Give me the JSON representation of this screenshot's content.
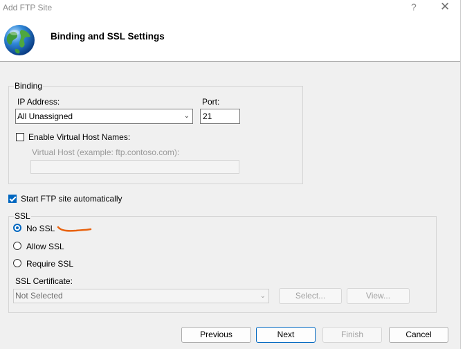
{
  "window": {
    "title": "Add FTP Site",
    "help_glyph": "?",
    "close_glyph": "✕"
  },
  "header": {
    "title": "Binding and SSL Settings",
    "icon": "globe-icon"
  },
  "binding": {
    "group_label": "Binding",
    "ip_label": "IP Address:",
    "ip_value": "All Unassigned",
    "port_label": "Port:",
    "port_value": "21",
    "virtual_hosts_label": "Enable Virtual Host Names:",
    "virtual_hosts_checked": false,
    "virtual_host_label": "Virtual Host (example: ftp.contoso.com):",
    "virtual_host_value": ""
  },
  "start_auto": {
    "label": "Start FTP site automatically",
    "checked": true
  },
  "ssl": {
    "group_label": "SSL",
    "options": [
      {
        "label": "No SSL",
        "checked": true
      },
      {
        "label": "Allow SSL",
        "checked": false
      },
      {
        "label": "Require SSL",
        "checked": false
      }
    ],
    "cert_label": "SSL Certificate:",
    "cert_value": "Not Selected",
    "select_button": "Select...",
    "view_button": "View..."
  },
  "footer": {
    "previous": "Previous",
    "next": "Next",
    "finish": "Finish",
    "cancel": "Cancel"
  },
  "colors": {
    "accent": "#0067c0",
    "annotation": "#e8620e"
  }
}
